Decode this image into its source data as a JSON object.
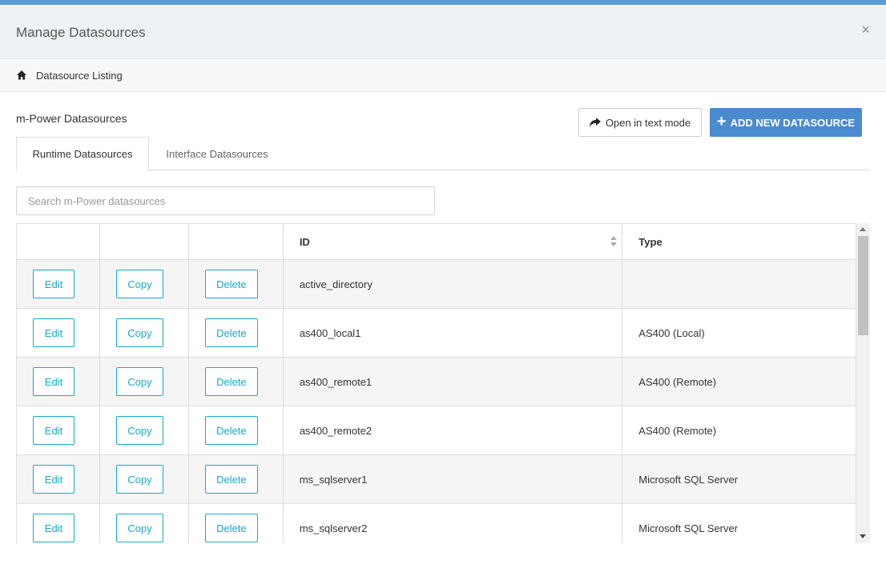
{
  "window": {
    "title": "Manage Datasources",
    "close_icon": "×"
  },
  "breadcrumb": {
    "icon": "home-icon",
    "label": "Datasource Listing"
  },
  "section": {
    "title": "m-Power Datasources"
  },
  "toolbar": {
    "open_text_mode_label": "Open in text mode",
    "add_label": "ADD NEW DATASOURCE",
    "add_color": "#4a8bd0"
  },
  "tabs": [
    {
      "label": "Runtime Datasources",
      "active": true
    },
    {
      "label": "Interface Datasources",
      "active": false
    }
  ],
  "search": {
    "placeholder": "Search m-Power datasources",
    "value": ""
  },
  "table": {
    "headers": [
      "",
      "",
      "",
      "ID",
      "Type"
    ],
    "action_labels": {
      "edit": "Edit",
      "copy": "Copy",
      "delete": "Delete"
    },
    "action_color": "#17a9c9",
    "rows": [
      {
        "id": "active_directory",
        "type": ""
      },
      {
        "id": "as400_local1",
        "type": "AS400 (Local)"
      },
      {
        "id": "as400_remote1",
        "type": "AS400 (Remote)"
      },
      {
        "id": "as400_remote2",
        "type": "AS400 (Remote)"
      },
      {
        "id": "ms_sqlserver1",
        "type": "Microsoft SQL Server"
      },
      {
        "id": "ms_sqlserver2",
        "type": "Microsoft SQL Server"
      }
    ]
  }
}
